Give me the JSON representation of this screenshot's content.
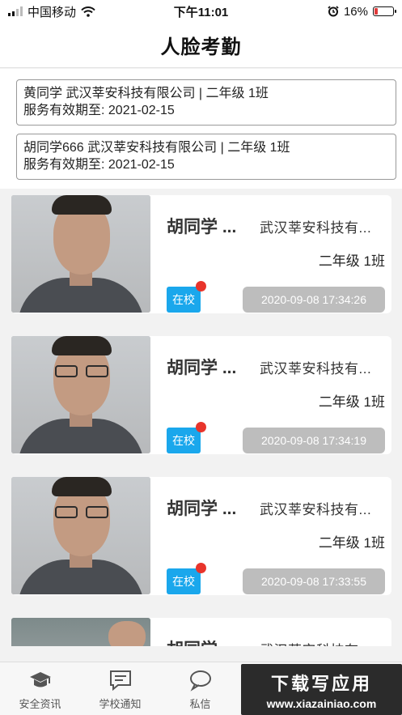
{
  "status_bar": {
    "carrier": "中国移动",
    "time": "下午11:01",
    "battery_percent": "16%",
    "battery_level": 0.16
  },
  "nav": {
    "title": "人脸考勤"
  },
  "students": [
    {
      "line1": "黄同学  武汉莘安科技有限公司 | 二年级 1班",
      "line2": "服务有效期至: 2021-02-15"
    },
    {
      "line1": "胡同学666  武汉莘安科技有限公司 | 二年级 1班",
      "line2": "服务有效期至: 2021-02-15"
    }
  ],
  "records": [
    {
      "name": "胡同学 ...",
      "company": "武汉莘安科技有...",
      "class": "二年级 1班",
      "status": "在校",
      "time": "2020-09-08 17:34:26"
    },
    {
      "name": "胡同学 ...",
      "company": "武汉莘安科技有...",
      "class": "二年级 1班",
      "status": "在校",
      "time": "2020-09-08 17:34:19"
    },
    {
      "name": "胡同学 ...",
      "company": "武汉莘安科技有...",
      "class": "二年级 1班",
      "status": "在校",
      "time": "2020-09-08 17:33:55"
    },
    {
      "name": "胡同学 ...",
      "company": "武汉莘安科技有...",
      "class": "",
      "status": "",
      "time": ""
    }
  ],
  "tabs": [
    {
      "label": "安全资讯",
      "icon": "graduation-cap-icon"
    },
    {
      "label": "学校通知",
      "icon": "message-square-icon"
    },
    {
      "label": "私信",
      "icon": "chat-bubble-icon"
    }
  ],
  "watermark": {
    "title": "下载写应用",
    "url": "www.xiazainiao.com"
  },
  "colors": {
    "accent": "#1aa7ec",
    "badge": "#e8342b",
    "time_pill": "#bdbdbd"
  }
}
